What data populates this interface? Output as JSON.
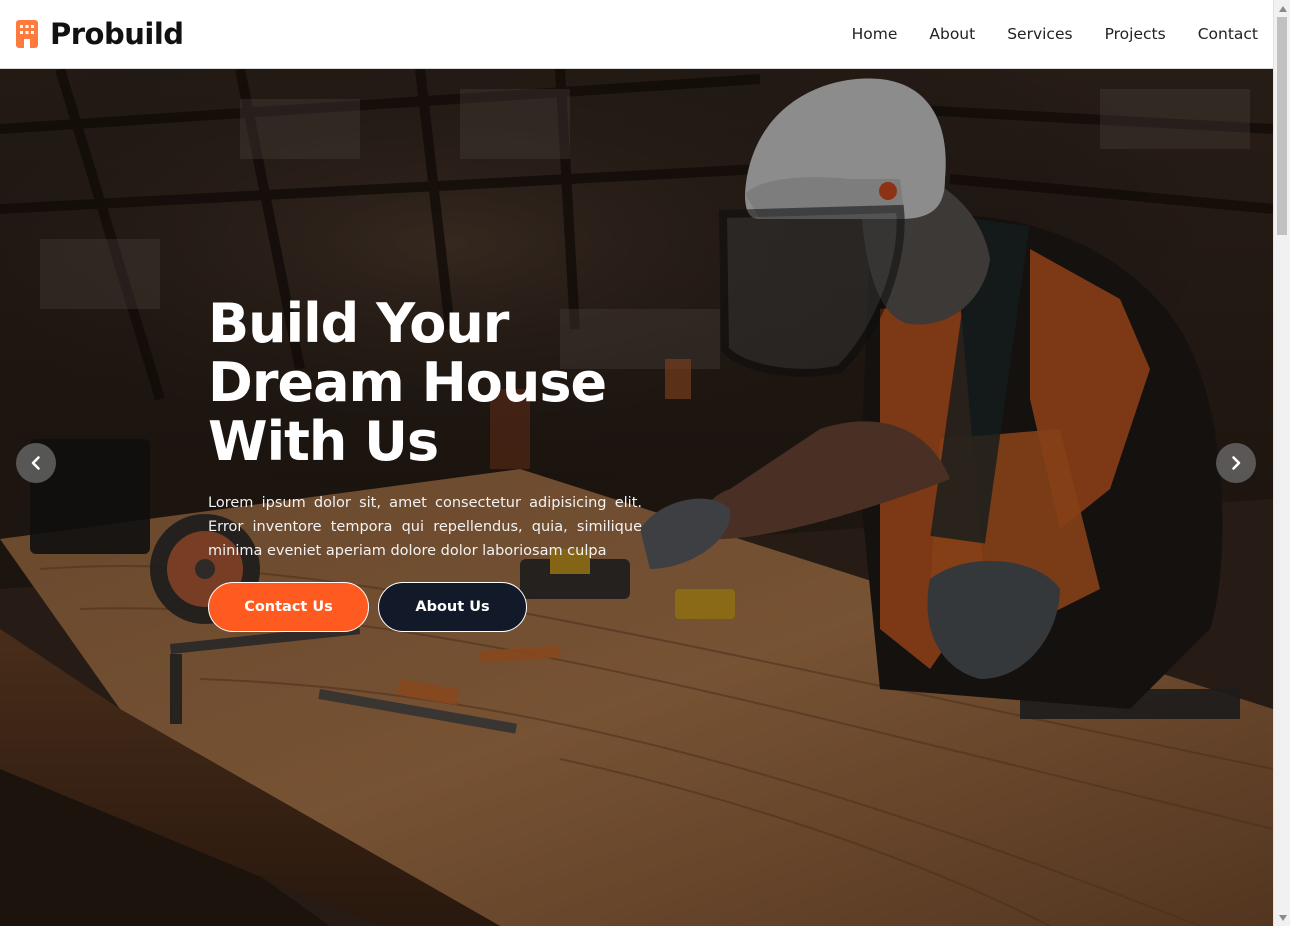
{
  "header": {
    "brand": "Probuild",
    "nav": [
      "Home",
      "About",
      "Services",
      "Projects",
      "Contact"
    ]
  },
  "hero": {
    "title": "Build Your\nDream House\nWith Us",
    "text": "Lorem ipsum dolor sit, amet consectetur adipisicing elit. Error inventore tempora qui repellendus, quia, similique minima eveniet aperiam dolore dolor laboriosam culpa",
    "buttons": {
      "contact": "Contact Us",
      "about": "About Us"
    }
  },
  "colors": {
    "accent": "#ff5a1f",
    "dark_button": "#121a2a",
    "brand_icon": "#ff7a3d"
  },
  "icons": {
    "brand": "building-icon",
    "prev": "chevron-left-icon",
    "next": "chevron-right-icon"
  }
}
